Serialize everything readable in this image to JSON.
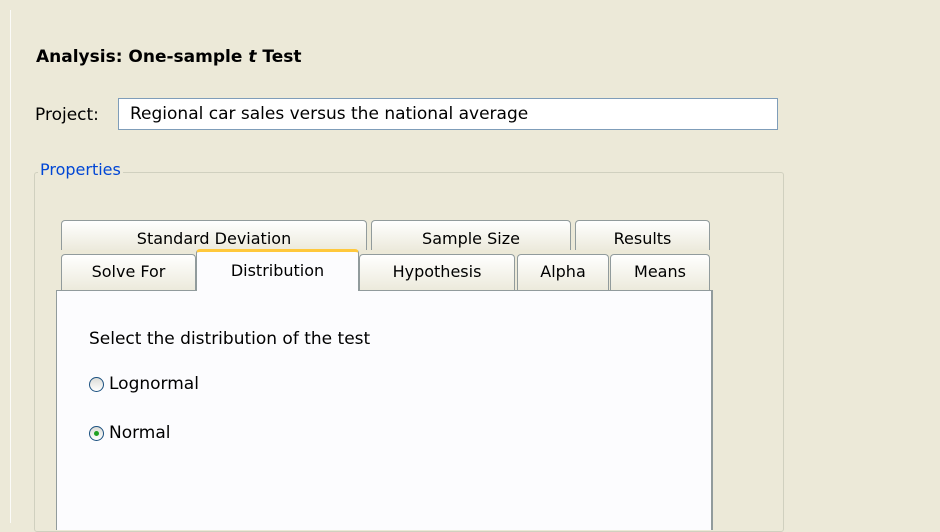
{
  "analysis": {
    "title_prefix": "Analysis: One-sample ",
    "title_t": "t",
    "title_suffix": " Test"
  },
  "project": {
    "label": "Project:",
    "value": "Regional car sales versus the national average"
  },
  "properties": {
    "legend": "Properties",
    "tabs_row1": [
      "Standard Deviation",
      "Sample Size",
      "Results"
    ],
    "tabs_row2": [
      "Solve For",
      "Distribution",
      "Hypothesis",
      "Alpha",
      "Means"
    ],
    "active_tab": "Distribution"
  },
  "distribution_panel": {
    "prompt": "Select the distribution of the test",
    "options": [
      {
        "label": "Lognormal",
        "selected": false
      },
      {
        "label": "Normal",
        "selected": true
      }
    ]
  },
  "colors": {
    "background": "#ece9d8",
    "legend_text": "#0046d5",
    "active_tab_highlight": "#ffc83c",
    "radio_selected_dot": "#21a121"
  }
}
